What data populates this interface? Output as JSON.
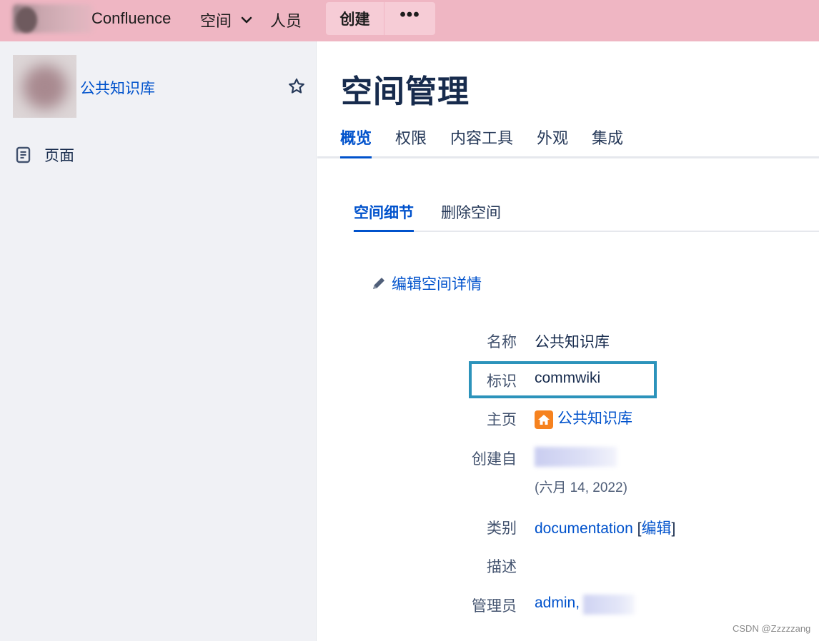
{
  "topbar": {
    "app_name": "Confluence",
    "nav": {
      "spaces": "空间",
      "people": "人员"
    },
    "create_label": "创建",
    "more_label": "•••",
    "background": "#efb6c3"
  },
  "sidebar": {
    "space_name": "公共知识库",
    "items": [
      {
        "label": "页面",
        "icon": "page-icon"
      }
    ]
  },
  "main": {
    "title": "空间管理",
    "tabs": [
      {
        "label": "概览",
        "active": true
      },
      {
        "label": "权限",
        "active": false
      },
      {
        "label": "内容工具",
        "active": false
      },
      {
        "label": "外观",
        "active": false
      },
      {
        "label": "集成",
        "active": false
      }
    ],
    "subtabs": [
      {
        "label": "空间细节",
        "active": true
      },
      {
        "label": "删除空间",
        "active": false
      }
    ],
    "edit_link": "编辑空间详情",
    "details": {
      "name_label": "名称",
      "name_value": "公共知识库",
      "key_label": "标识",
      "key_value": "commwiki",
      "home_label": "主页",
      "home_value": "公共知识库",
      "creator_label": "创建自",
      "created_date": "(六月 14, 2022)",
      "category_label": "类别",
      "category_value": "documentation",
      "category_bracket_open": " [",
      "category_edit": "编辑",
      "category_bracket_close": "]",
      "desc_label": "描述",
      "admin_label": "管理员",
      "admin_value": "admin,"
    },
    "accent": "#0052cc",
    "highlight_color": "#2c93bb"
  },
  "watermark": "CSDN @Zzzzzang"
}
